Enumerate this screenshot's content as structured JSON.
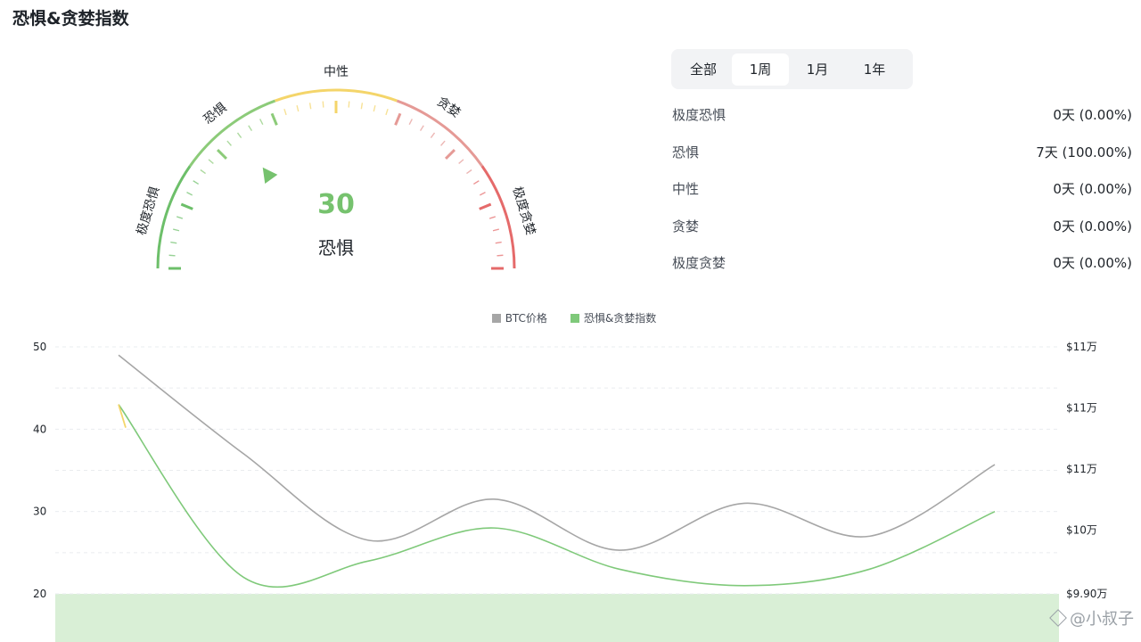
{
  "header": {
    "title": "恐惧&贪婪指数"
  },
  "gauge": {
    "value": "30",
    "value_number": 30,
    "status": "恐惧",
    "min": 0,
    "max": 100,
    "zones": [
      {
        "label": "极度恐惧",
        "color": "#6dbf6a"
      },
      {
        "label": "恐惧",
        "color": "#8ccb79"
      },
      {
        "label": "中性",
        "color": "#f4d56a"
      },
      {
        "label": "贪婪",
        "color": "#e59a96"
      },
      {
        "label": "极度贪婪",
        "color": "#e56a6a"
      }
    ],
    "value_color": "#76c26e"
  },
  "period_tabs": {
    "items": [
      {
        "label": "全部"
      },
      {
        "label": "1周"
      },
      {
        "label": "1月"
      },
      {
        "label": "1年"
      }
    ],
    "active": "1周"
  },
  "stats": [
    {
      "label": "极度恐惧",
      "value": "0天 (0.00%)"
    },
    {
      "label": "恐惧",
      "value": "7天 (100.00%)"
    },
    {
      "label": "中性",
      "value": "0天 (0.00%)"
    },
    {
      "label": "贪婪",
      "value": "0天 (0.00%)"
    },
    {
      "label": "极度贪婪",
      "value": "0天 (0.00%)"
    }
  ],
  "legend": {
    "btc_label": "BTC价格",
    "btc_color": "#a6a6a6",
    "index_label": "恐惧&贪婪指数",
    "index_color": "#7fc97a"
  },
  "chart_data": {
    "type": "line",
    "x": [
      1,
      2,
      3,
      4,
      5,
      6,
      7,
      8
    ],
    "series": [
      {
        "name": "恐惧&贪婪指数",
        "axis": "left",
        "values": [
          43,
          22,
          24,
          28,
          23,
          21,
          23,
          30
        ]
      },
      {
        "name": "BTC价格",
        "axis": "right",
        "values": [
          49,
          37,
          26.5,
          31.5,
          25.3,
          31,
          27,
          35.7
        ]
      }
    ],
    "ylim": [
      20,
      50
    ],
    "yticks": [
      "50",
      "40",
      "30",
      "20"
    ],
    "y2_ticks": [
      "$11万",
      "$11万",
      "$11万",
      "$10万",
      "$9.90万"
    ],
    "grid": true,
    "shaded_band_below": 20
  },
  "watermark": {
    "text": "@小叔子"
  }
}
